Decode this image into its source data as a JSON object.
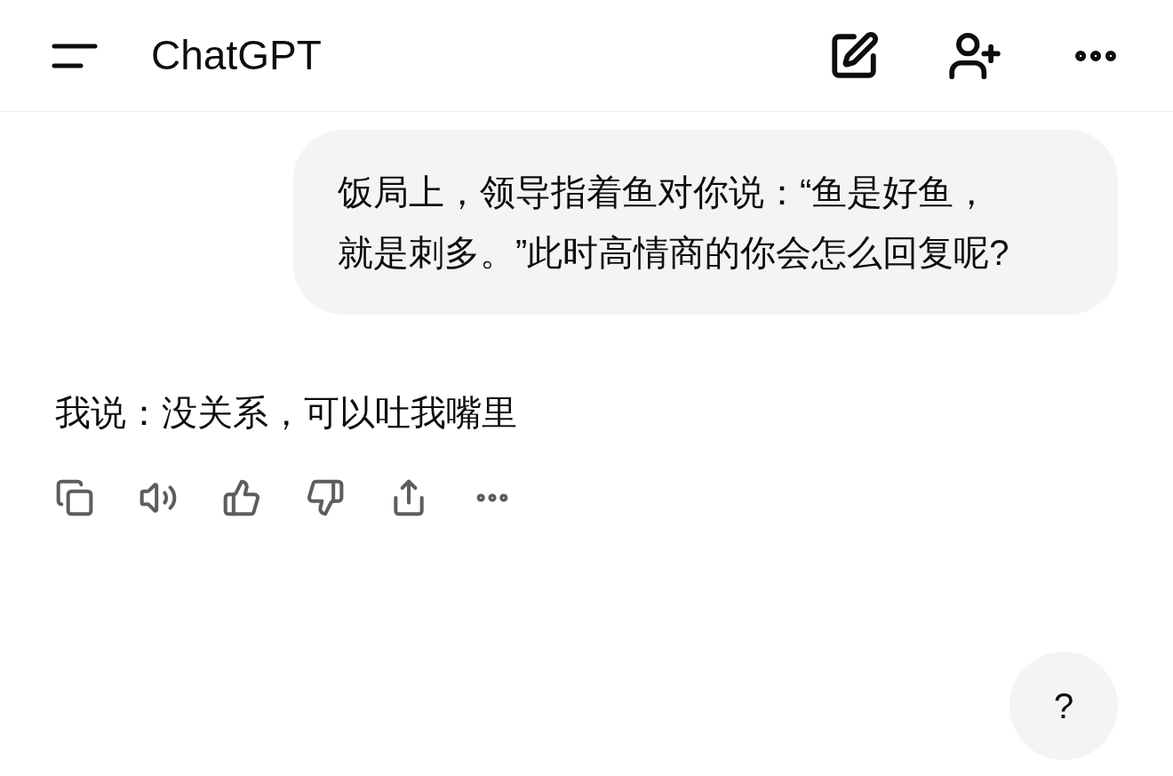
{
  "header": {
    "title": "ChatGPT"
  },
  "messages": [
    {
      "kind": "user",
      "text": "饭局上，领导指着鱼对你说：“鱼是好鱼，就是刺多。”此时高情商的你会怎么回复呢?"
    },
    {
      "kind": "assistant",
      "text": "我说：没关系，可以吐我嘴里"
    }
  ],
  "help_button": {
    "label": "?"
  }
}
